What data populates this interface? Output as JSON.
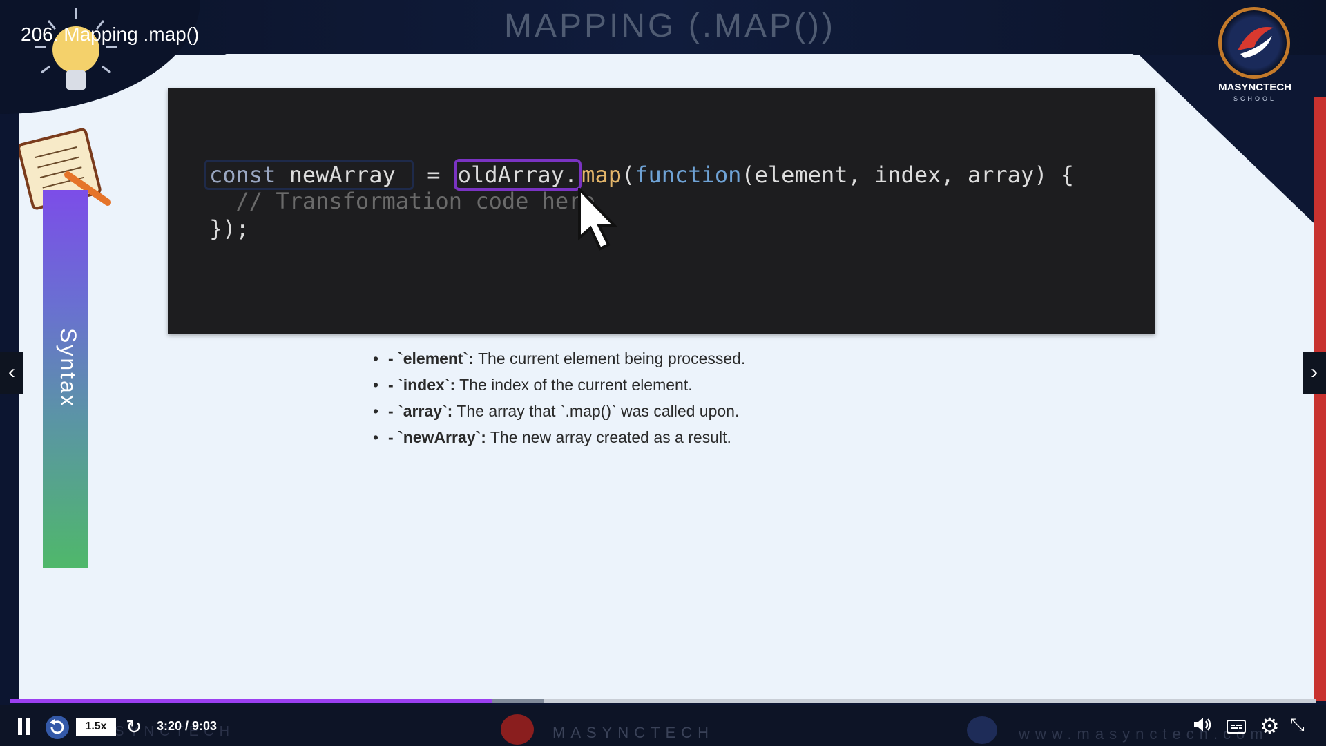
{
  "video": {
    "title": "206. Mapping .map()"
  },
  "slide": {
    "heading": "MAPPING (.MAP())",
    "side_label": "Syntax",
    "logo_text": "MASYNCTECH",
    "logo_sub": "SCHOOL",
    "code": {
      "line1": {
        "kw_const": "const",
        "var_name": " newArray ",
        "eq": " = ",
        "obj": "oldArray.",
        "method": "map",
        "paren_open": "(",
        "func_kw": "function",
        "params": "(element, index, array) {"
      },
      "line2": "  // Transformation code here",
      "line3": "});"
    },
    "bullets": [
      {
        "prefix": "- `",
        "term": "element",
        "suffix": "`:",
        "desc": " The current element being processed."
      },
      {
        "prefix": "- `",
        "term": "index",
        "suffix": "`:",
        "desc": " The index of the current element."
      },
      {
        "prefix": "- `",
        "term": "array",
        "suffix": "`:",
        "desc": " The array that `.map()` was called upon."
      },
      {
        "prefix": "- `",
        "term": "newArray",
        "suffix": "`:",
        "desc": " The new array created as a result."
      }
    ]
  },
  "player": {
    "speed": "1.5x",
    "time": "3:20 / 9:03",
    "progress": 0.369,
    "watermark": "MASYNCTECH",
    "watermark_left": "MASYNCTECH",
    "url": "www.masynctech.com",
    "progress_color": "#9b3ff0"
  },
  "icons": {
    "prev": "chevron-left-icon",
    "next": "chevron-right-icon",
    "pause": "pause-icon",
    "rewind": "rewind-icon",
    "forward": "forward-icon",
    "volume": "volume-icon",
    "captions": "captions-icon",
    "settings": "gear-icon",
    "fullscreen": "exit-fullscreen-icon"
  },
  "glyphs": {
    "prev": "‹",
    "next": "›",
    "bullet": "•",
    "forward": "↻",
    "settings": "⚙",
    "fullscreen": "⤡"
  }
}
